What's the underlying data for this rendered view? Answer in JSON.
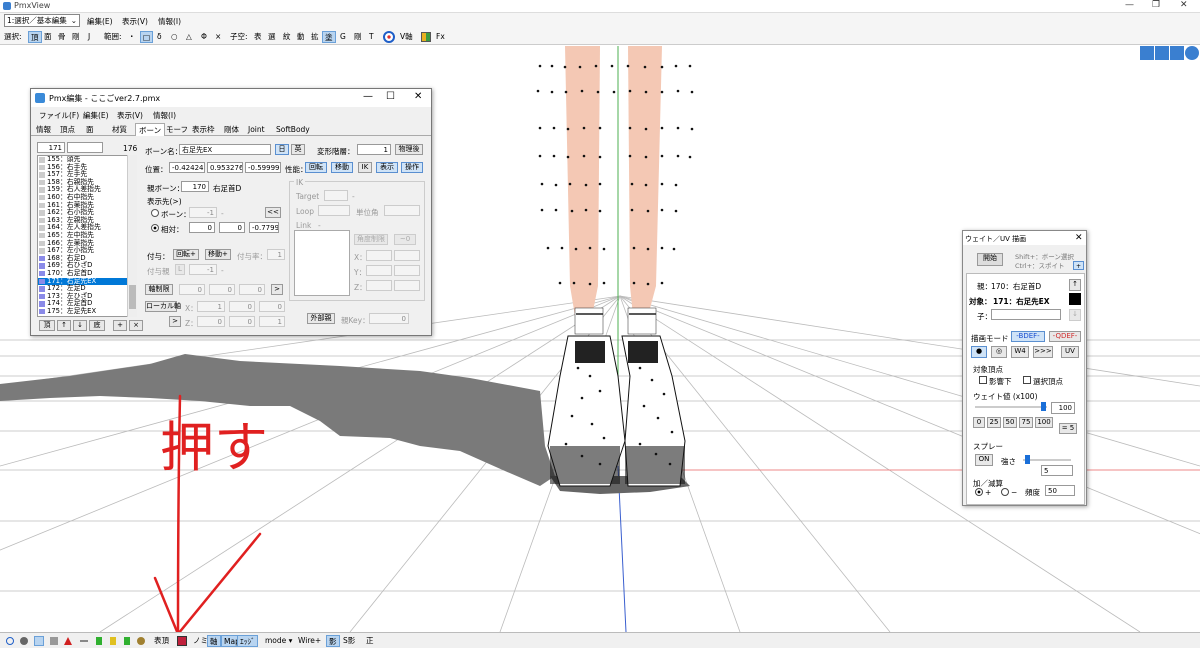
{
  "app": {
    "title": "PmxView",
    "win_min": "—",
    "win_max": "❐",
    "win_close": "✕"
  },
  "menubar": {
    "mode_select": "1:選択／基本編集",
    "items": [
      "編集(E)",
      "表示(V)",
      "情報(I)"
    ]
  },
  "toolbar": {
    "select_label": "選択:",
    "select_items": [
      "頂",
      "面",
      "骨",
      "剛",
      "J"
    ],
    "range_label": "範囲:",
    "range_items": [
      "・",
      "□",
      "δ",
      "○",
      "△",
      "Φ",
      "×"
    ],
    "axis_label": "子空:",
    "axis_items": [
      "表",
      "選",
      "紋",
      "動",
      "拡",
      "塗",
      "G",
      "剛",
      "T"
    ],
    "vaxis": "V軸",
    "fx": "Fx"
  },
  "annotation": {
    "text": "押す",
    "color": "#e02020"
  },
  "dialog": {
    "title": "Pmx編集 - ここごver2.7.pmx",
    "menu": [
      "ファイル(F)",
      "編集(E)",
      "表示(V)",
      "情報(I)"
    ],
    "tabs": [
      "情報",
      "頂点",
      "面",
      "材質",
      "ボーン",
      "モーフ",
      "表示枠",
      "剛体",
      "Joint",
      "SoftBody"
    ],
    "active_tab": "ボーン",
    "index_value": "171",
    "count": "176",
    "bones": [
      {
        "label": "155：頭先",
        "ik": false
      },
      {
        "label": "156：右手先",
        "ik": false
      },
      {
        "label": "157：左手先",
        "ik": false
      },
      {
        "label": "158：右親指先",
        "ik": false
      },
      {
        "label": "159：右人差指先",
        "ik": false
      },
      {
        "label": "160：右中指先",
        "ik": false
      },
      {
        "label": "161：右薬指先",
        "ik": false
      },
      {
        "label": "162：右小指先",
        "ik": false
      },
      {
        "label": "163：左親指先",
        "ik": false
      },
      {
        "label": "164：左人差指先",
        "ik": false
      },
      {
        "label": "165：左中指先",
        "ik": false
      },
      {
        "label": "166：左薬指先",
        "ik": false
      },
      {
        "label": "167：左小指先",
        "ik": false
      },
      {
        "label": "168：右足D",
        "ik": true
      },
      {
        "label": "169：右ひざD",
        "ik": true
      },
      {
        "label": "170：右足首D",
        "ik": true
      },
      {
        "label": "171：右足先EX",
        "ik": true,
        "selected": true
      },
      {
        "label": "172：左足D",
        "ik": true
      },
      {
        "label": "173：左ひざD",
        "ik": true
      },
      {
        "label": "174：左足首D",
        "ik": true
      },
      {
        "label": "175：左足先EX",
        "ik": true
      }
    ],
    "list_buttons": [
      "頂",
      "↑",
      "↓",
      "底",
      "+",
      "×"
    ],
    "bone_name_label": "ボーン名：",
    "bone_name": "右足先EX",
    "btn_jp": "日",
    "btn_en": "英",
    "deform_label": "変形階層：",
    "deform_value": "1",
    "physics_after": "物理後",
    "pos_label": "位置：",
    "pos_x": "-0.424242",
    "pos_y": "0.953276",
    "pos_z": "-0.599998",
    "perf_label": "性能：",
    "perf_buttons": [
      "回転",
      "移動",
      "IK",
      "表示",
      "操作"
    ],
    "parent_label": "親ボーン：",
    "parent_index": "170",
    "parent_name": "右足首D",
    "tail_label": "表示先(>)",
    "tail_bone_label": "ボーン：",
    "tail_bone_value": "-1",
    "tail_bone_dash": "-",
    "tail_rel_label": "相対：",
    "tail_rel": [
      "0",
      "0",
      "-0.7799"
    ],
    "tail_back": "<<",
    "grant_label": "付与：",
    "grant_rot": "回転+",
    "grant_move": "移動+",
    "grant_rate_label": "付与率：",
    "grant_rate": "1",
    "grant_parent_label": "付与親",
    "grant_l": "L",
    "grant_parent_value": "-1",
    "grant_parent_dash": "-",
    "axis_fix": "軸制限",
    "axis_fix_values": [
      "0",
      "0",
      "0"
    ],
    "axis_fix_btn": ">",
    "local_axis": "ローカル軸",
    "local_x_label": "X：",
    "local_z_label": "Z：",
    "local_x": [
      "1",
      "0",
      "0"
    ],
    "local_z": [
      "0",
      "0",
      "1"
    ],
    "local_btn": ">",
    "ik_label": "IK",
    "ik_target": "Target",
    "ik_loop": "Loop",
    "ik_unit": "単位角",
    "ik_link": "Link",
    "ik_dash": "-",
    "angle_limit": "角度制限",
    "angle_btn": "~0",
    "xyz": [
      "X：",
      "Y：",
      "Z："
    ],
    "external": "外部親",
    "parent_key_label": "親Key：",
    "parent_key": "0"
  },
  "weight_panel": {
    "title": "ウェイト／UV 描画",
    "open": "開始",
    "hint1": "Shift+：ボーン選択",
    "hint2": "Ctrl+：スポイト",
    "plus": "+",
    "parent_label": "親：",
    "parent_value": "170：右足首D",
    "up": "↑",
    "target_label": "対象：",
    "target_value": "171：右足先EX",
    "child_label": "子：",
    "down": "↓",
    "draw_mode_label": "描画モード",
    "bdef": "-BDEF-",
    "qdef": "-QDEF-",
    "modes": [
      "●",
      "◎",
      "W4",
      ">>>",
      "UV"
    ],
    "target_vertex_label": "対象頂点",
    "under_influence": "影響下",
    "selected_vertex": "選択頂点",
    "weight_label": "ウェイト値 (x100)",
    "weight_value": "100",
    "presets": [
      "0",
      "25",
      "50",
      "75",
      "100"
    ],
    "eq5": "= 5",
    "spray_label": "スプレー",
    "on": "ON",
    "strength_label": "強さ",
    "strength_value": "5",
    "addsub_label": "加／減算",
    "plus_label": "+",
    "minus_label": "−",
    "freq_label": "頻度",
    "freq_value": "50"
  },
  "statusbar": {
    "table_label": "表頂",
    "item_no": "ノミ",
    "axis": "軸",
    "btn_map": "Map",
    "edge": "ｴｯｼﾞ",
    "mode": "mode ▾",
    "wire": "Wire+",
    "shadow": "影",
    "sshadow": "S影",
    "front": "正"
  }
}
